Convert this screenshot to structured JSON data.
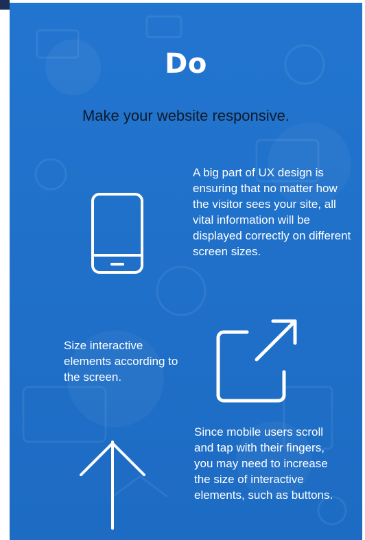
{
  "title": "Do",
  "subtitle": "Make your website responsive.",
  "paragraphs": {
    "ux_design": "A big part of UX design is ensuring that no matter how the visitor sees your site, all vital information will be displayed correctly on different screen sizes.",
    "size_interactive": "Size interactive elements according to the screen.",
    "mobile_users": "Since mobile users scroll and tap with their fingers, you may need to increase the size of interactive elements, such as buttons."
  },
  "icons": {
    "phone": "smartphone-icon",
    "external": "external-link-icon",
    "arrow": "arrow-up-icon"
  },
  "colors": {
    "background": "#1f6fc8",
    "title": "#ffffff",
    "subtitle": "#0e1a2b",
    "body_text": "#ffffff"
  }
}
